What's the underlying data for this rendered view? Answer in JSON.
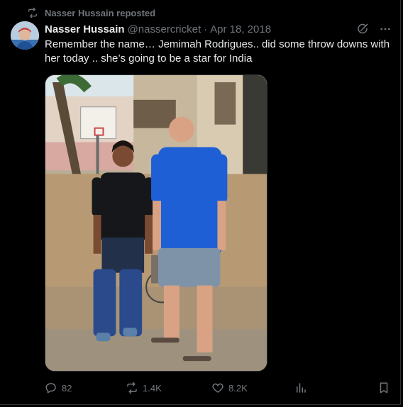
{
  "repost": {
    "label": "Nasser Hussain reposted",
    "icon": "repost-icon"
  },
  "author": {
    "name": "Nasser Hussain",
    "handle": "@nassercricket",
    "date": "Apr 18, 2018",
    "avatar_icon": "avatar"
  },
  "tweet": {
    "text": "Remember the name… Jemimah Rodrigues.. did some throw downs with her today .. she’s going to be a star for India"
  },
  "media": {
    "kind": "photo"
  },
  "actions": {
    "replies": "82",
    "reposts": "1.4K",
    "likes": "8.2K"
  },
  "colors": {
    "background": "#000000",
    "text": "#e7e9ea",
    "muted": "#71767b",
    "border": "#2f3336"
  }
}
